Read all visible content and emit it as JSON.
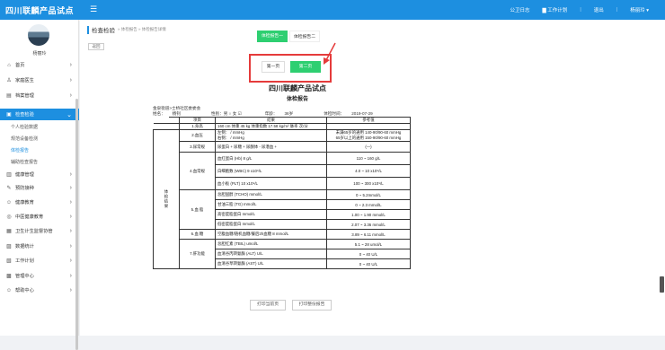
{
  "header": {
    "brand": "四川联麟产品试点",
    "menu_icon": "menu-icon",
    "links": [
      "公卫日志",
      "工作计划",
      "退出",
      "杨丽玲 ▾"
    ]
  },
  "sidebar": {
    "user": "杨丽玲",
    "items": [
      {
        "icon": "⌂",
        "label": "首页"
      },
      {
        "icon": "♙",
        "label": "家庭医生"
      },
      {
        "icon": "▤",
        "label": "档案管理"
      },
      {
        "icon": "▣",
        "label": "检查检验"
      },
      {
        "icon": "▥",
        "label": "健康管理"
      },
      {
        "icon": "✎",
        "label": "预防接种"
      },
      {
        "icon": "☺",
        "label": "健康教育"
      },
      {
        "icon": "◎",
        "label": "中医健康教育"
      },
      {
        "icon": "▦",
        "label": "卫生计生监督协管"
      },
      {
        "icon": "▨",
        "label": "数据统计"
      },
      {
        "icon": "▧",
        "label": "工作计划"
      },
      {
        "icon": "▩",
        "label": "管理中心"
      },
      {
        "icon": "☺",
        "label": "帮助中心"
      }
    ],
    "subitems": [
      "个人检验数据",
      "规范设备检测",
      "体检报告",
      "辅助检查报告"
    ]
  },
  "main": {
    "breadcrumb_title": "检查检验",
    "breadcrumb_rest": "» 体检报告 » 体检报告详情",
    "back": "返回",
    "report_tab1": "体检报告一",
    "report_tab2": "体检报告二",
    "page1": "第一页",
    "page2": "第二页",
    "title": "四川联麟产品试点",
    "subtitle": "体检报告",
    "info_line1": "金泉街道>士桥社区委委会",
    "name_label": "姓名：",
    "name_value": "杨钊",
    "sex": "性别：男 ○ 女 ☑",
    "age_label": "年龄：",
    "age_value": "36岁",
    "date_label": "体检时间：",
    "date_value": "2019-07-29",
    "print_current": "打印当前页",
    "print_report": "打印整份报告"
  },
  "table": {
    "head": [
      "项目",
      "结果",
      "参考值"
    ],
    "side_label": "体检结果",
    "rows": [
      {
        "item": "1.身高",
        "result": "160 cm 体重 45 kg 体重指数 17.58 kg/m² 脉率 次/分",
        "ref": ""
      },
      {
        "item": "2.血压",
        "result": "左侧： / mmHg\n右侧： / mmHg",
        "ref": "未满65岁的通用 140-90/90-60 mmHg\n65岁以上的通用 150-90/90-60 mmHg"
      },
      {
        "item": "3.尿常规",
        "result": "尿蛋白 + 尿糖 + 尿酮体 - 尿潜血 +",
        "ref": "(—)"
      },
      {
        "item": "4.血常规",
        "result": "血红蛋白 (Hb) 8 g/L",
        "ref": "110 ~ 160 g/L"
      },
      {
        "item": "",
        "result": "白细胞数 (WBC) 9 x10⁹/L",
        "ref": "4.0 ~ 10 x10⁹/L"
      },
      {
        "item": "",
        "result": "血小板 (PLT) 10 x10⁹/L",
        "ref": "100 ~ 300 x10⁹/L"
      },
      {
        "item": "5.血 脂",
        "result": "总胆固醇 (TCHO) mmol/L",
        "ref": "0 ~ 5.2mmol/L"
      },
      {
        "item": "",
        "result": "甘油三脂 (TG) mmol/L",
        "ref": "0 ~ 2.3 mmol/L"
      },
      {
        "item": "",
        "result": "高密度脂蛋白 mmol/L",
        "ref": "1.00 ~ 1.90 mmol/L"
      },
      {
        "item": "",
        "result": "低密度脂蛋白 mmol/L",
        "ref": "2.07 ~ 3.36 mmol/L"
      },
      {
        "item": "6.血 糖",
        "result": "空腹血糖/随机血糖/餐后2h血糖 8 mmol/L",
        "ref": "3.89 ~ 6.11 mmol/L"
      },
      {
        "item": "7.肝功能",
        "result": "总胆红素 (TBIL) umol/L",
        "ref": "5.1 ~ 28 umol/L"
      },
      {
        "item": "",
        "result": "血清谷丙转氨酶 (ALT) U/L",
        "ref": "0 ~ 40 U/L"
      },
      {
        "item": "",
        "result": "血清谷草转氨酶 (AST) U/L",
        "ref": "0 ~ 40 U/L"
      }
    ]
  },
  "colors": {
    "primary": "#1d8fe0",
    "success": "#2ecf71",
    "highlight": "#e53b3b"
  }
}
